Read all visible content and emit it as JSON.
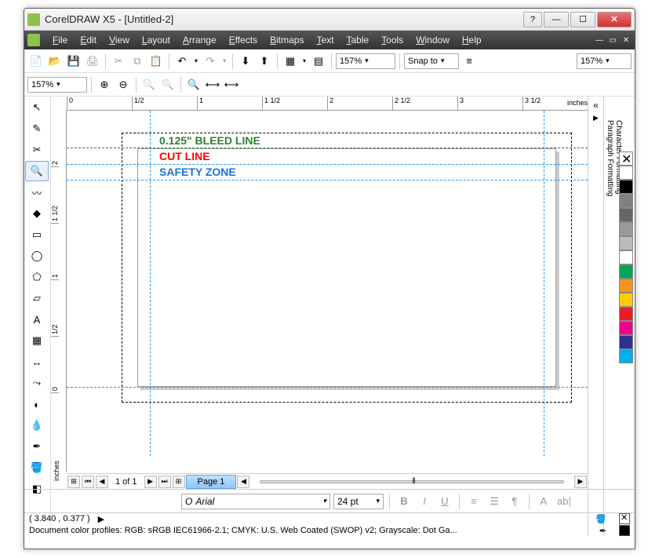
{
  "title": "CorelDRAW X5 - [Untitled-2]",
  "menu": [
    "File",
    "Edit",
    "View",
    "Layout",
    "Arrange",
    "Effects",
    "Bitmaps",
    "Text",
    "Table",
    "Tools",
    "Window",
    "Help"
  ],
  "zoom1": "157%",
  "snap": "Snap to",
  "zoom2": "157%",
  "zoom3": "157%",
  "ruler_unit": "inches",
  "ruler_h": [
    "0",
    "1/2",
    "1",
    "1 1/2",
    "2",
    "2 1/2",
    "3",
    "3 1/2"
  ],
  "ruler_v": [
    "2",
    "1 1/2",
    "1",
    "1/2",
    "0"
  ],
  "canvas_texts": [
    {
      "t": "0.125\" BLEED LINE",
      "c": "#2e7d32",
      "y": 30
    },
    {
      "t": "CUT LINE",
      "c": "#ff0000",
      "y": 50
    },
    {
      "t": "SAFETY ZONE",
      "c": "#1976d2",
      "y": 70
    }
  ],
  "palette": [
    "#ffffff",
    "#000000",
    "#808080",
    "#666666",
    "#999999",
    "#bbbbbb",
    "#ffffff",
    "#00a651",
    "#f7941d",
    "#ffcc00",
    "#ed1c24",
    "#ec008c",
    "#2e3192",
    "#00aeef"
  ],
  "docker": [
    "Paragraph Formatting",
    "Character Formatting"
  ],
  "pager": {
    "count": "1 of 1",
    "tab": "Page 1"
  },
  "font": {
    "name": "Arial",
    "size": "24 pt"
  },
  "status": {
    "coords": "( 3.840 , 0.377 )",
    "profiles": "Document color profiles: RGB: sRGB IEC61966-2.1; CMYK: U.S. Web Coated (SWOP) v2; Grayscale: Dot Ga..."
  }
}
